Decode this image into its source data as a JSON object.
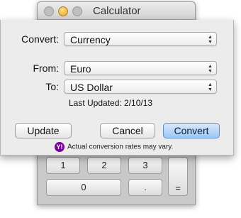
{
  "calculator": {
    "title": "Calculator",
    "keys": [
      "1",
      "2",
      "3",
      "0",
      ".",
      "="
    ]
  },
  "converter": {
    "convert_label": "Convert:",
    "convert_value": "Currency",
    "from_label": "From:",
    "from_value": "Euro",
    "to_label": "To:",
    "to_value": "US Dollar",
    "last_updated": "Last Updated: 2/10/13",
    "update_button": "Update",
    "cancel_button": "Cancel",
    "convert_button": "Convert",
    "disclaimer": "Actual conversion rates may vary."
  },
  "colors": {
    "default_button": "#9dc6f3",
    "yahoo": "#7b0099"
  }
}
